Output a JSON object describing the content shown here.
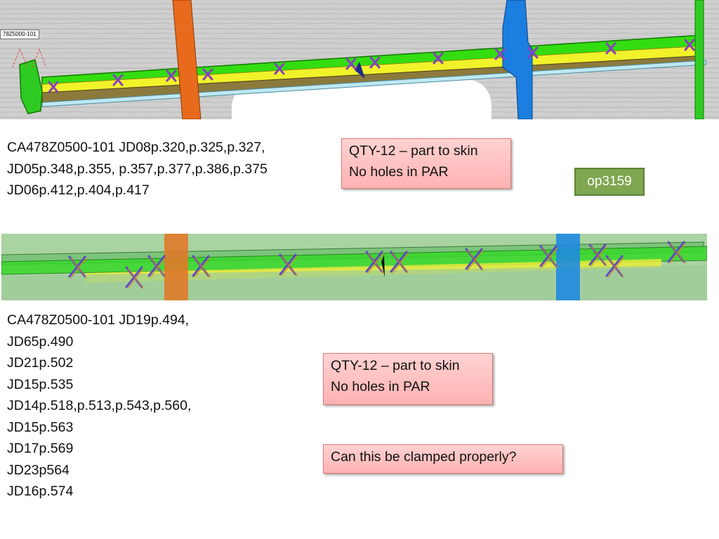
{
  "cad_top": {
    "part_tag": "78Z5000-101"
  },
  "refs_top": {
    "lines": [
      "CA478Z0500-101 JD08p.320,p.325,p.327,",
      "JD05p.348,p.355, p.357,p.377,p.386,p.375",
      "JD06p.412,p.404,p.417"
    ]
  },
  "note_top": {
    "lines": [
      "QTY-12 – part to skin",
      "No holes in PAR"
    ]
  },
  "op_badge": {
    "label": "op3159"
  },
  "refs_bottom": {
    "lines": [
      "CA478Z0500-101 JD19p.494,",
      "JD65p.490",
      "JD21p.502",
      "JD15p.535",
      "JD14p.518,p.513,p.543,p.560,",
      "JD15p.563",
      "JD17p.569",
      "JD23p564",
      "JD16p.574"
    ]
  },
  "note_bottom": {
    "lines": [
      "QTY-12 – part to skin",
      "No holes in PAR"
    ]
  },
  "note_clamp": {
    "text": "Can this be clamped properly?"
  },
  "colors": {
    "green": "#22dd11",
    "yellow": "#eeee22",
    "orange": "#e86a1c",
    "blue": "#1a7fe0",
    "marker": "#8a3fbf",
    "badge": "#7fa651",
    "note": "#ffc0c0"
  }
}
